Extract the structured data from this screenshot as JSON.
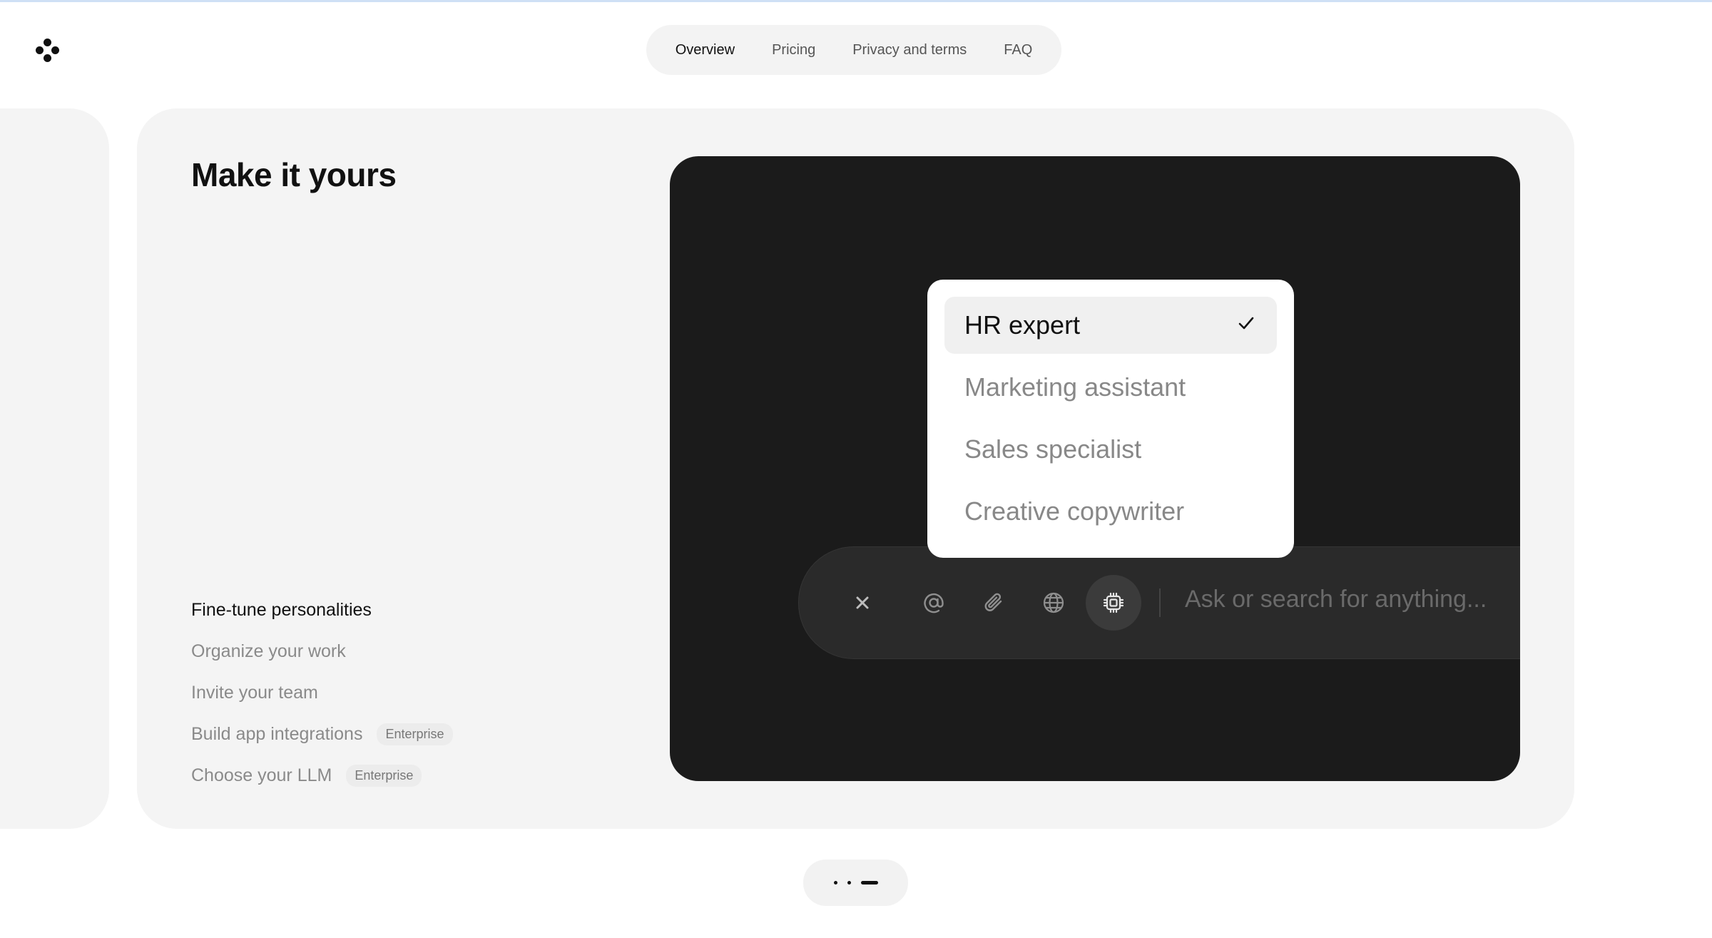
{
  "nav": {
    "items": [
      {
        "label": "Overview",
        "active": true
      },
      {
        "label": "Pricing",
        "active": false
      },
      {
        "label": "Privacy and terms",
        "active": false
      },
      {
        "label": "FAQ",
        "active": false
      }
    ]
  },
  "section": {
    "title": "Make it yours",
    "features": [
      {
        "label": "Fine-tune personalities",
        "active": true,
        "badge": ""
      },
      {
        "label": "Organize your work",
        "active": false,
        "badge": ""
      },
      {
        "label": "Invite your team",
        "active": false,
        "badge": ""
      },
      {
        "label": "Build app integrations",
        "active": false,
        "badge": "Enterprise"
      },
      {
        "label": "Choose your LLM",
        "active": false,
        "badge": "Enterprise"
      }
    ]
  },
  "demo": {
    "dropdown": {
      "options": [
        {
          "label": "HR expert",
          "selected": true
        },
        {
          "label": "Marketing assistant",
          "selected": false
        },
        {
          "label": "Sales specialist",
          "selected": false
        },
        {
          "label": "Creative copywriter",
          "selected": false
        }
      ]
    },
    "input": {
      "placeholder": "Ask or search for anything...",
      "buttons": [
        "close-icon",
        "at-icon",
        "paperclip-icon",
        "globe-icon",
        "chip-icon"
      ]
    }
  },
  "pager": {
    "total": 3,
    "current": 3
  }
}
